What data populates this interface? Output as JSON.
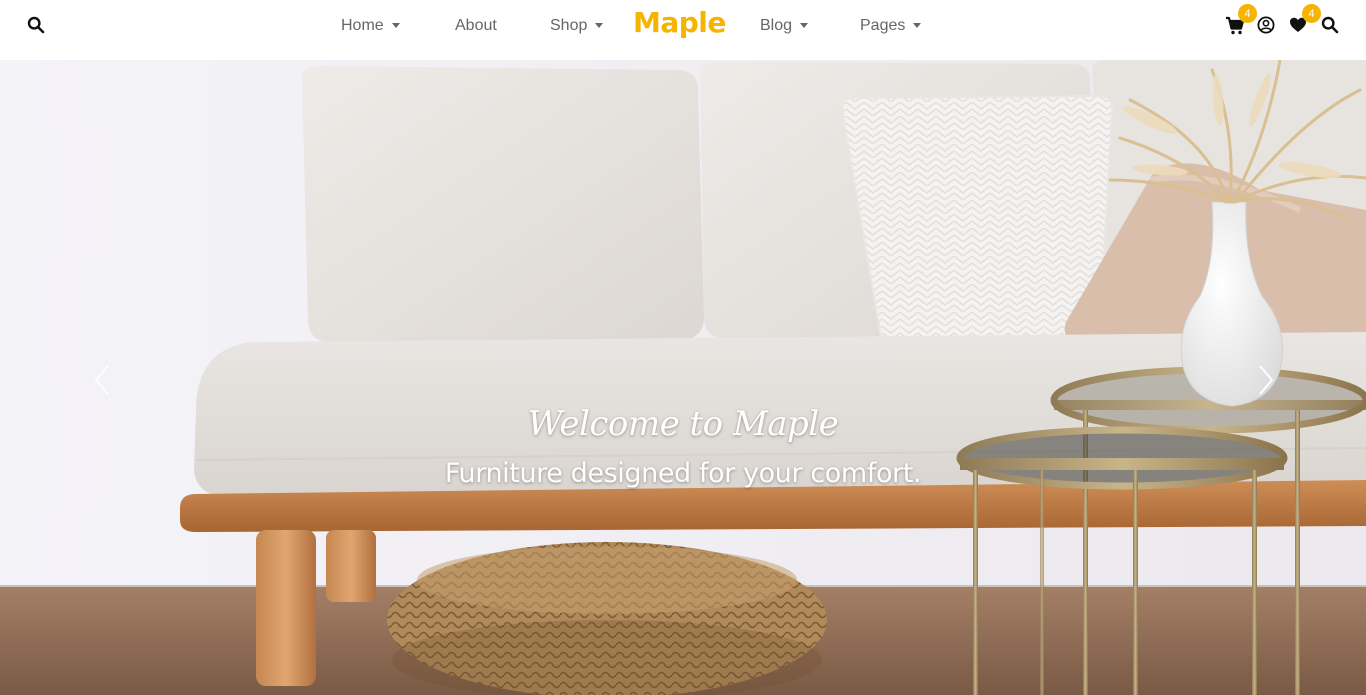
{
  "header": {
    "logo": "Maple",
    "nav": [
      {
        "label": "Home",
        "has_dropdown": true
      },
      {
        "label": "About",
        "has_dropdown": false
      },
      {
        "label": "Shop",
        "has_dropdown": true
      },
      {
        "label": "Blog",
        "has_dropdown": true
      },
      {
        "label": "Pages",
        "has_dropdown": true
      }
    ],
    "cart_count": "4",
    "wishlist_count": "4",
    "icons": [
      "search-icon",
      "cart-icon",
      "user-icon",
      "heart-icon",
      "search-icon"
    ]
  },
  "hero": {
    "title": "Welcome to Maple",
    "subtitle": "Furniture designed for your comfort.",
    "controls": [
      "chevron-left-icon",
      "chevron-right-icon"
    ]
  },
  "colors": {
    "accent": "#f5b400",
    "nav_text": "#666666",
    "icon": "#111111"
  }
}
